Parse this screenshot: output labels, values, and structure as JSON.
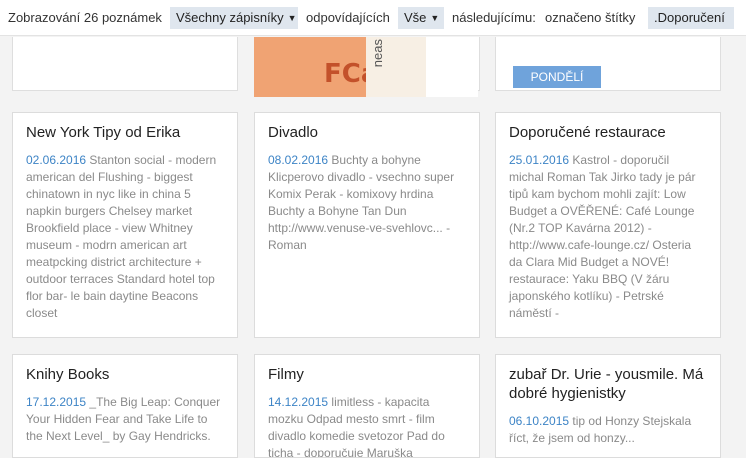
{
  "filter": {
    "prefix": "Zobrazování 26 poznámek",
    "notebooks_dropdown": "Všechny zápisníky",
    "matching": "odpovídajících",
    "all_dropdown": "Vše",
    "following": "následujícímu:",
    "tagged": "označeno štítky",
    "tag": ".Doporučení"
  },
  "previous_row": {
    "button_label": "PONDĚLÍ",
    "thumbnail_letters": "FCa",
    "thumbnail_side_text": "neas"
  },
  "notes": [
    {
      "title": "New York Tipy od Erika",
      "date": "02.06.2016",
      "snippet": " Stanton social - modern american del Flushing - biggest chinatown in nyc like in china 5 napkin burgers Chelsey market Brookfield place - view Whitney museum - modrn american art meatpcking district architecture + outdoor terraces Standard hotel top flor bar- le bain daytine Beacons closet"
    },
    {
      "title": "Divadlo",
      "date": "08.02.2016",
      "snippet": " Buchty a bohyne Klicperovo divadlo - vsechno super Komix Perak - komixovy hrdina Buchty a Bohyne Tan Dun http://www.venuse-ve-svehlovc... - Roman"
    },
    {
      "title": "Doporučené restaurace",
      "date": "25.01.2016",
      "snippet": " Kastrol - doporučil michal Roman Tak Jirko tady je pár tipů kam bychom mohli zajít: Low Budget a OVĚŘENÉ: Café Lounge (Nr.2 TOP Kavárna 2012) - http://www.cafe-lounge.cz/ Osteria da Clara Mid Budget a NOVÉ! restaurace: Yaku BBQ (V žáru japonského kotlíku) - Petrské náměstí -"
    },
    {
      "title": "Knihy Books",
      "date": "17.12.2015",
      "snippet": " _The Big Leap: Conquer Your Hidden Fear and Take Life to the Next Level_ by Gay Hendricks."
    },
    {
      "title": "Filmy",
      "date": "14.12.2015",
      "snippet": " limitless - kapacita mozku Odpad mesto smrt - film divadlo komedie svetozor Pad do ticha - doporučuje Maruška"
    },
    {
      "title": "zubař Dr. Urie - yousmile. Má dobré hygienistky",
      "date": "06.10.2015",
      "snippet": " tip od Honzy Stejskala říct, že jsem od honzy..."
    }
  ]
}
